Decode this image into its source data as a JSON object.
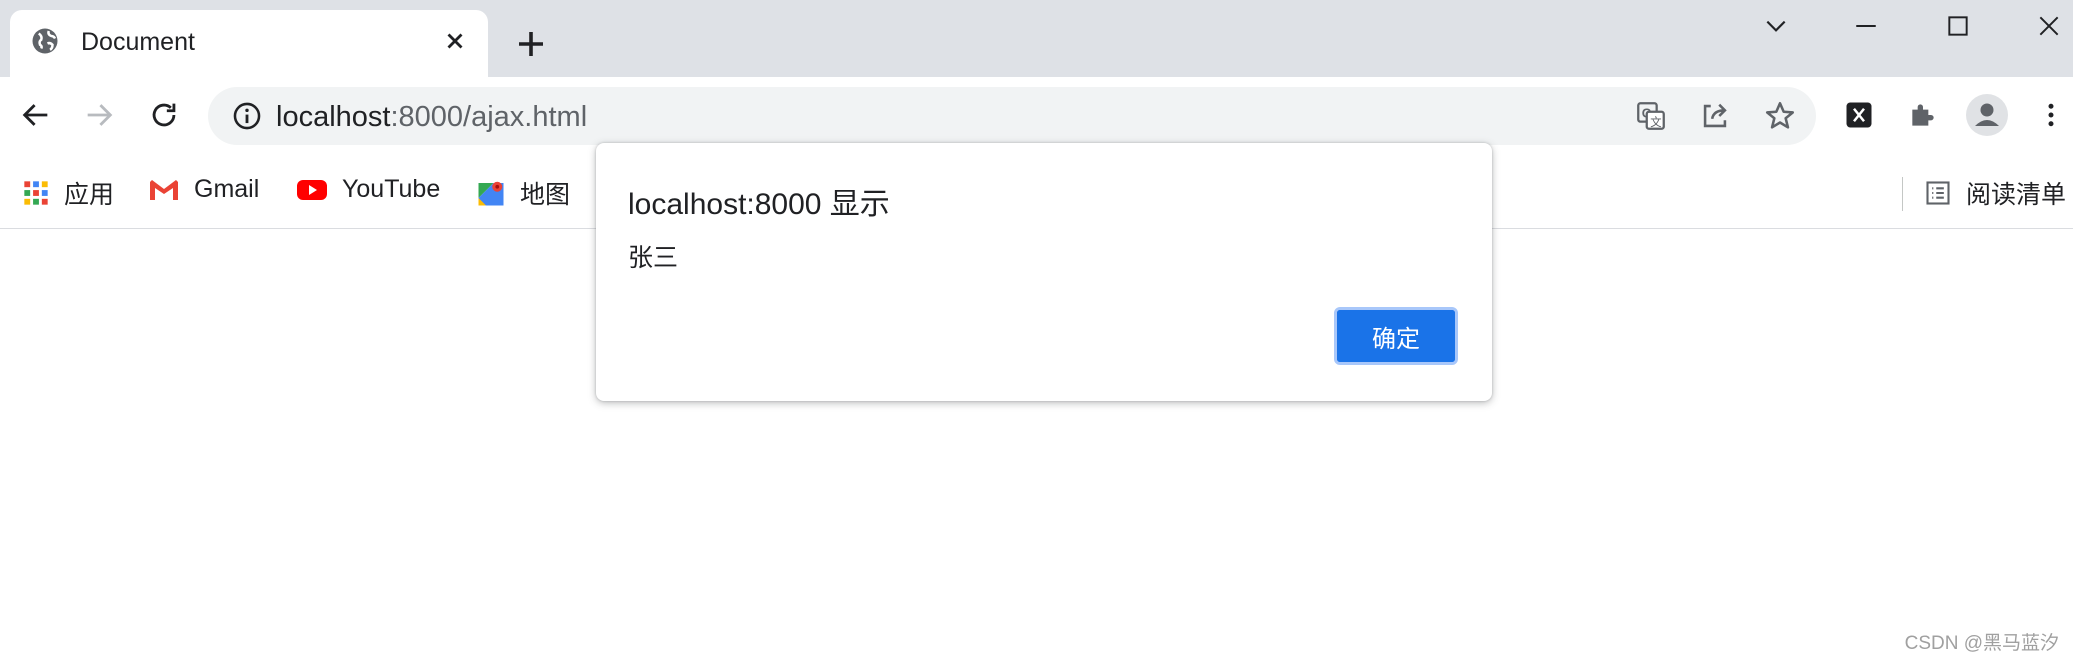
{
  "tab": {
    "title": "Document",
    "favicon": "globe-icon"
  },
  "window_controls": [
    "tab-search-icon",
    "minimize-icon",
    "maximize-icon",
    "close-icon"
  ],
  "address_bar": {
    "url_host": "localhost",
    "url_rest": ":8000/ajax.html",
    "left_icon": "info-icon",
    "right_icons": [
      "translate-icon",
      "share-icon",
      "bookmark-star-icon"
    ]
  },
  "toolbar_icons": [
    "extension-x-icon",
    "extensions-puzzle-icon",
    "profile-avatar-icon",
    "more-menu-icon"
  ],
  "bookmarks": {
    "items": [
      {
        "label": "应用",
        "icon": "apps-grid-icon"
      },
      {
        "label": "Gmail",
        "icon": "gmail-icon"
      },
      {
        "label": "YouTube",
        "icon": "youtube-icon"
      },
      {
        "label": "地图",
        "icon": "maps-icon"
      }
    ],
    "reading_list": {
      "label": "阅读清单",
      "icon": "reading-list-icon"
    }
  },
  "dialog": {
    "title": "localhost:8000 显示",
    "message": "张三",
    "ok_label": "确定"
  },
  "watermark": "CSDN @黑马蓝汐",
  "colors": {
    "tabstrip": "#dee1e6",
    "omnibox": "#f1f3f4",
    "accent": "#1a73e8",
    "youtube": "#ff0000"
  }
}
